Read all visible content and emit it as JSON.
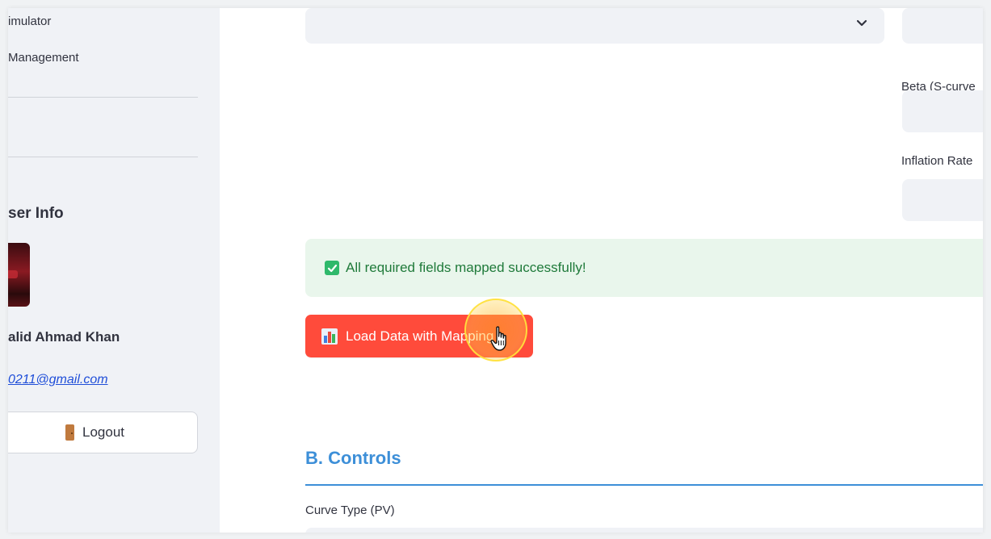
{
  "sidebar": {
    "nav_items": [
      {
        "label": "imulator"
      },
      {
        "label": "Management"
      }
    ],
    "user_info": {
      "heading": "ser Info",
      "name": "alid Ahmad Khan",
      "email": "0211@gmail.com"
    },
    "logout_label": "Logout"
  },
  "main": {
    "right_fields": {
      "beta_label": "Beta (S-curve",
      "inflation_label": "Inflation Rate"
    },
    "alert": {
      "message": "All required fields mapped successfully!",
      "color": "#1f7a3a"
    },
    "load_button_label": "Load Data with Mapping",
    "section_title": "B. Controls",
    "curve_type_label": "Curve Type (PV)"
  },
  "colors": {
    "accent_blue": "#3d8fd8",
    "button_red": "#ff4b3b",
    "success_bg": "#e9f6ec",
    "sidebar_bg": "#f0f2f6"
  }
}
